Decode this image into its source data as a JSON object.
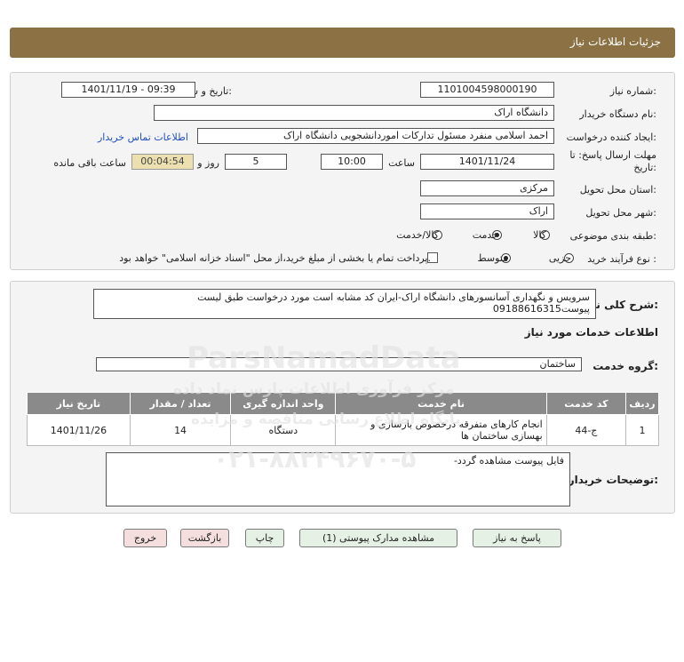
{
  "header": {
    "title": "جزئیات اطلاعات نیاز"
  },
  "form": {
    "need_number_label": "شماره نیاز:",
    "need_number_value": "1101004598000190",
    "announce_label": "تاریخ و ساعت اعلان عمومی:",
    "announce_value": "1401/11/19 - 09:39",
    "buyer_org_label": "نام دستگاه خریدار:",
    "buyer_org_value": "دانشگاه اراک",
    "requester_label": "ایجاد کننده درخواست:",
    "requester_value": "احمد  اسلامی منفرد مسئول تدارکات اموردانشجویی دانشگاه اراک",
    "contact_link": "اطلاعات تماس خریدار",
    "deadline_label_line1": "مهلت ارسال پاسخ: تا",
    "deadline_label_line2": "تاریخ:",
    "deadline_date": "1401/11/24",
    "time_label": "ساعت",
    "deadline_time": "10:00",
    "days_value": "5",
    "days_label": "روز و",
    "remaining_time": "00:04:54",
    "remaining_label": "ساعت باقی مانده",
    "province_label": "استان محل تحویل:",
    "province_value": "مرکزی",
    "city_label": "شهر محل تحویل:",
    "city_value": "اراک",
    "category_label": "طبقه بندی موضوعی:",
    "category_options": [
      "کالا",
      "خدمت",
      "کالا/خدمت"
    ],
    "category_selected": "خدمت",
    "process_label": "نوع فرآیند خرید :",
    "process_options": [
      "جزیی",
      "متوسط"
    ],
    "process_selected": "متوسط",
    "payment_note": "پرداخت تمام یا بخشی از مبلغ خرید،از محل \"اسناد خزانه اسلامی\" خواهد بود."
  },
  "details": {
    "summary_label": "شرح کلی نیاز:",
    "summary_value": "سرویس و نگهداری آسانسورهای دانشگاه اراک-ایران کد مشابه است مورد درخواست طبق لیست پیوست09188616315",
    "services_heading": "اطلاعات خدمات مورد نیاز",
    "service_group_label": "گروه خدمت:",
    "service_group_value": "ساختمان",
    "table": {
      "headers": [
        "ردیف",
        "کد خدمت",
        "نام خدمت",
        "واحد اندازه گیری",
        "تعداد / مقدار",
        "تاریخ نیاز"
      ],
      "rows": [
        [
          "1",
          "ج-44",
          "انجام کارهای متفرقه درخصوص بازسازی و بهسازی ساختمان ها",
          "دستگاه",
          "14",
          "1401/11/26"
        ]
      ]
    },
    "buyer_notes_label": "توضیحات خریدار:",
    "buyer_notes_value": "فایل پیوست مشاهده گردد-"
  },
  "buttons": {
    "respond": "پاسخ به نیاز",
    "view_docs": "مشاهده مدارک پیوستی (1)",
    "print": "چاپ",
    "back": "بازگشت",
    "exit": "خروج"
  },
  "watermark": {
    "line1": "ParsNamadData",
    "line2": "مرکز فرآوری اطلاعات پارس نماد داده",
    "line3": "پایگاه اطلاع رسانی مناقصه و مزایده",
    "line4": "۰۲۱-۸۸۳۴۹۶۷۰-۵"
  }
}
